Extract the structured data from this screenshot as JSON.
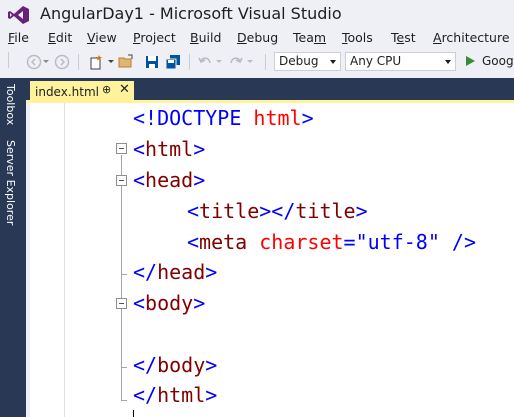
{
  "window": {
    "title": "AngularDay1 - Microsoft Visual Studio"
  },
  "menu": [
    {
      "label": "File",
      "u": 0
    },
    {
      "label": "Edit",
      "u": 0
    },
    {
      "label": "View",
      "u": 0
    },
    {
      "label": "Project",
      "u": 0
    },
    {
      "label": "Build",
      "u": 0
    },
    {
      "label": "Debug",
      "u": 0
    },
    {
      "label": "Team",
      "u": 3
    },
    {
      "label": "Tools",
      "u": 0
    },
    {
      "label": "Test",
      "u": 1
    },
    {
      "label": "Architecture",
      "u": 0
    }
  ],
  "toolbar": {
    "config_value": "Debug",
    "platform_value": "Any CPU",
    "run_label": "Googl"
  },
  "side_tabs": [
    "Toolbox",
    "Server Explorer"
  ],
  "doc_tab": {
    "name": "index.html",
    "pin": "⊕",
    "close": "✕"
  },
  "code": {
    "doctype": "<!DOCTYPE ",
    "doctype_name": "html",
    "doctype_close": ">",
    "html_open_lt": "<",
    "html_open_name": "html",
    "html_open_gt": ">",
    "head_open_lt": "<",
    "head_open_name": "head",
    "head_open_gt": ">",
    "title_lt": "<",
    "title_name": "title",
    "title_mid": "></",
    "title_name2": "title",
    "title_gt": ">",
    "meta_lt": "<",
    "meta_name": "meta",
    "meta_attr": " charset",
    "meta_eq": "=",
    "meta_val": "\"utf-8\"",
    "meta_close": " />",
    "head_close_lt": "</",
    "head_close_name": "head",
    "head_close_gt": ">",
    "body_open_lt": "<",
    "body_open_name": "body",
    "body_open_gt": ">",
    "body_close_lt": "</",
    "body_close_name": "body",
    "body_close_gt": ">",
    "html_close_lt": "</",
    "html_close_name": "html",
    "html_close_gt": ">"
  },
  "colors": {
    "tag_bracket": "#0000ff",
    "tag_name": "#800000",
    "attr_name": "#ff0000",
    "attr_value": "#0000ff",
    "panel": "#293955",
    "active_tab": "#fff29d"
  }
}
